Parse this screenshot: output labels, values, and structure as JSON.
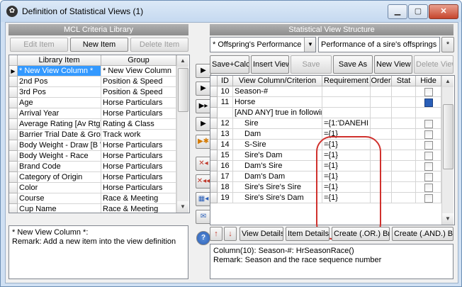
{
  "window": {
    "title": "Definition of Statistical Views  (1)",
    "controls": {
      "minimize": "▁",
      "maximize": "▢",
      "close": "✕"
    }
  },
  "left_panel": {
    "header": "MCL Criteria Library",
    "buttons": {
      "edit": "Edit Item",
      "new": "New Item",
      "delete": "Delete Item"
    },
    "columns": [
      "Library Item",
      "Group"
    ],
    "rows": [
      {
        "item": "* New View Column *",
        "group": "* New View Column"
      },
      {
        "item": "2nd Pos",
        "group": "Position & Speed"
      },
      {
        "item": "3rd Pos",
        "group": "Position & Speed"
      },
      {
        "item": "Age",
        "group": "Horse Particulars"
      },
      {
        "item": "Arrival Year",
        "group": "Horse Particulars"
      },
      {
        "item": "Average Rating [Av Rtg]",
        "group": "Rating & Class"
      },
      {
        "item": "Barrier Trial Date & Grou",
        "group": "Track work"
      },
      {
        "item": "Body Weight - Draw [B W",
        "group": "Horse Particulars"
      },
      {
        "item": "Body Weight - Race",
        "group": "Horse Particulars"
      },
      {
        "item": "Brand Code",
        "group": "Horse Particulars"
      },
      {
        "item": "Category of Origin",
        "group": "Horse Particulars"
      },
      {
        "item": "Color",
        "group": "Horse Particulars"
      },
      {
        "item": "Course",
        "group": "Race & Meeting"
      },
      {
        "item": "Cup Name",
        "group": "Race & Meeting"
      }
    ],
    "description": "* New View Column *:\nRemark: Add a new item into the view definition"
  },
  "middle_buttons": {
    "b1": "▶",
    "b2": "▶",
    "b3": "▶▸",
    "b4": "▶",
    "b5": "▶✱",
    "b6": "✕◂",
    "b7": "✕◂◂",
    "b8": "▦◂",
    "b9": "✉",
    "help": "?"
  },
  "right_panel": {
    "header": "Statistical View Structure",
    "combo_value": "* Offspring's Performance",
    "view_name": "Performance of a sire's offsprings",
    "star_button": "*",
    "toolbar": {
      "save_calc": "Save+Calc",
      "insert_view": "Insert View",
      "save": "Save",
      "save_as": "Save As",
      "new_view": "New View",
      "delete_view": "Delete View"
    },
    "columns": [
      "ID",
      "View Column/Criterion",
      "Requirement",
      "Order",
      "Stat",
      "Hide"
    ],
    "rows": [
      {
        "id": "10",
        "criterion": "Season-#",
        "requirement": "",
        "hide": false
      },
      {
        "id": "11",
        "criterion": "Horse",
        "requirement": "",
        "hide": true
      },
      {
        "id": "",
        "criterion": "[AND ANY] true in followin",
        "requirement": "",
        "hide": null
      },
      {
        "id": "12",
        "criterion": "Sire",
        "requirement": "={1:'DANEHI",
        "hide": false
      },
      {
        "id": "13",
        "criterion": "Dam",
        "requirement": "={1}",
        "hide": false
      },
      {
        "id": "14",
        "criterion": "S-Sire",
        "requirement": "={1}",
        "hide": false
      },
      {
        "id": "15",
        "criterion": "Sire's Dam",
        "requirement": "={1}",
        "hide": false
      },
      {
        "id": "16",
        "criterion": "Dam's Sire",
        "requirement": "={1}",
        "hide": false
      },
      {
        "id": "17",
        "criterion": "Dam's Dam",
        "requirement": "={1}",
        "hide": false
      },
      {
        "id": "18",
        "criterion": "Sire's Sire's Sire",
        "requirement": "={1}",
        "hide": false
      },
      {
        "id": "19",
        "criterion": "Sire's Sire's Dam",
        "requirement": "={1}",
        "hide": false
      }
    ],
    "bottom_buttons": {
      "up": "↑",
      "down": "↓",
      "view_details": "View Details",
      "item_details": "Item Details",
      "create_or": "Create (.OR.) Br",
      "create_and": "Create (.AND.) Br"
    },
    "description": "Column(10): Season-#: HrSeasonRace()\nRemark: Season and the race sequence number"
  },
  "colors": {
    "selection": "#3399ff",
    "highlight_oval": "#d0312d",
    "header_gray": "#9c9c9c"
  }
}
